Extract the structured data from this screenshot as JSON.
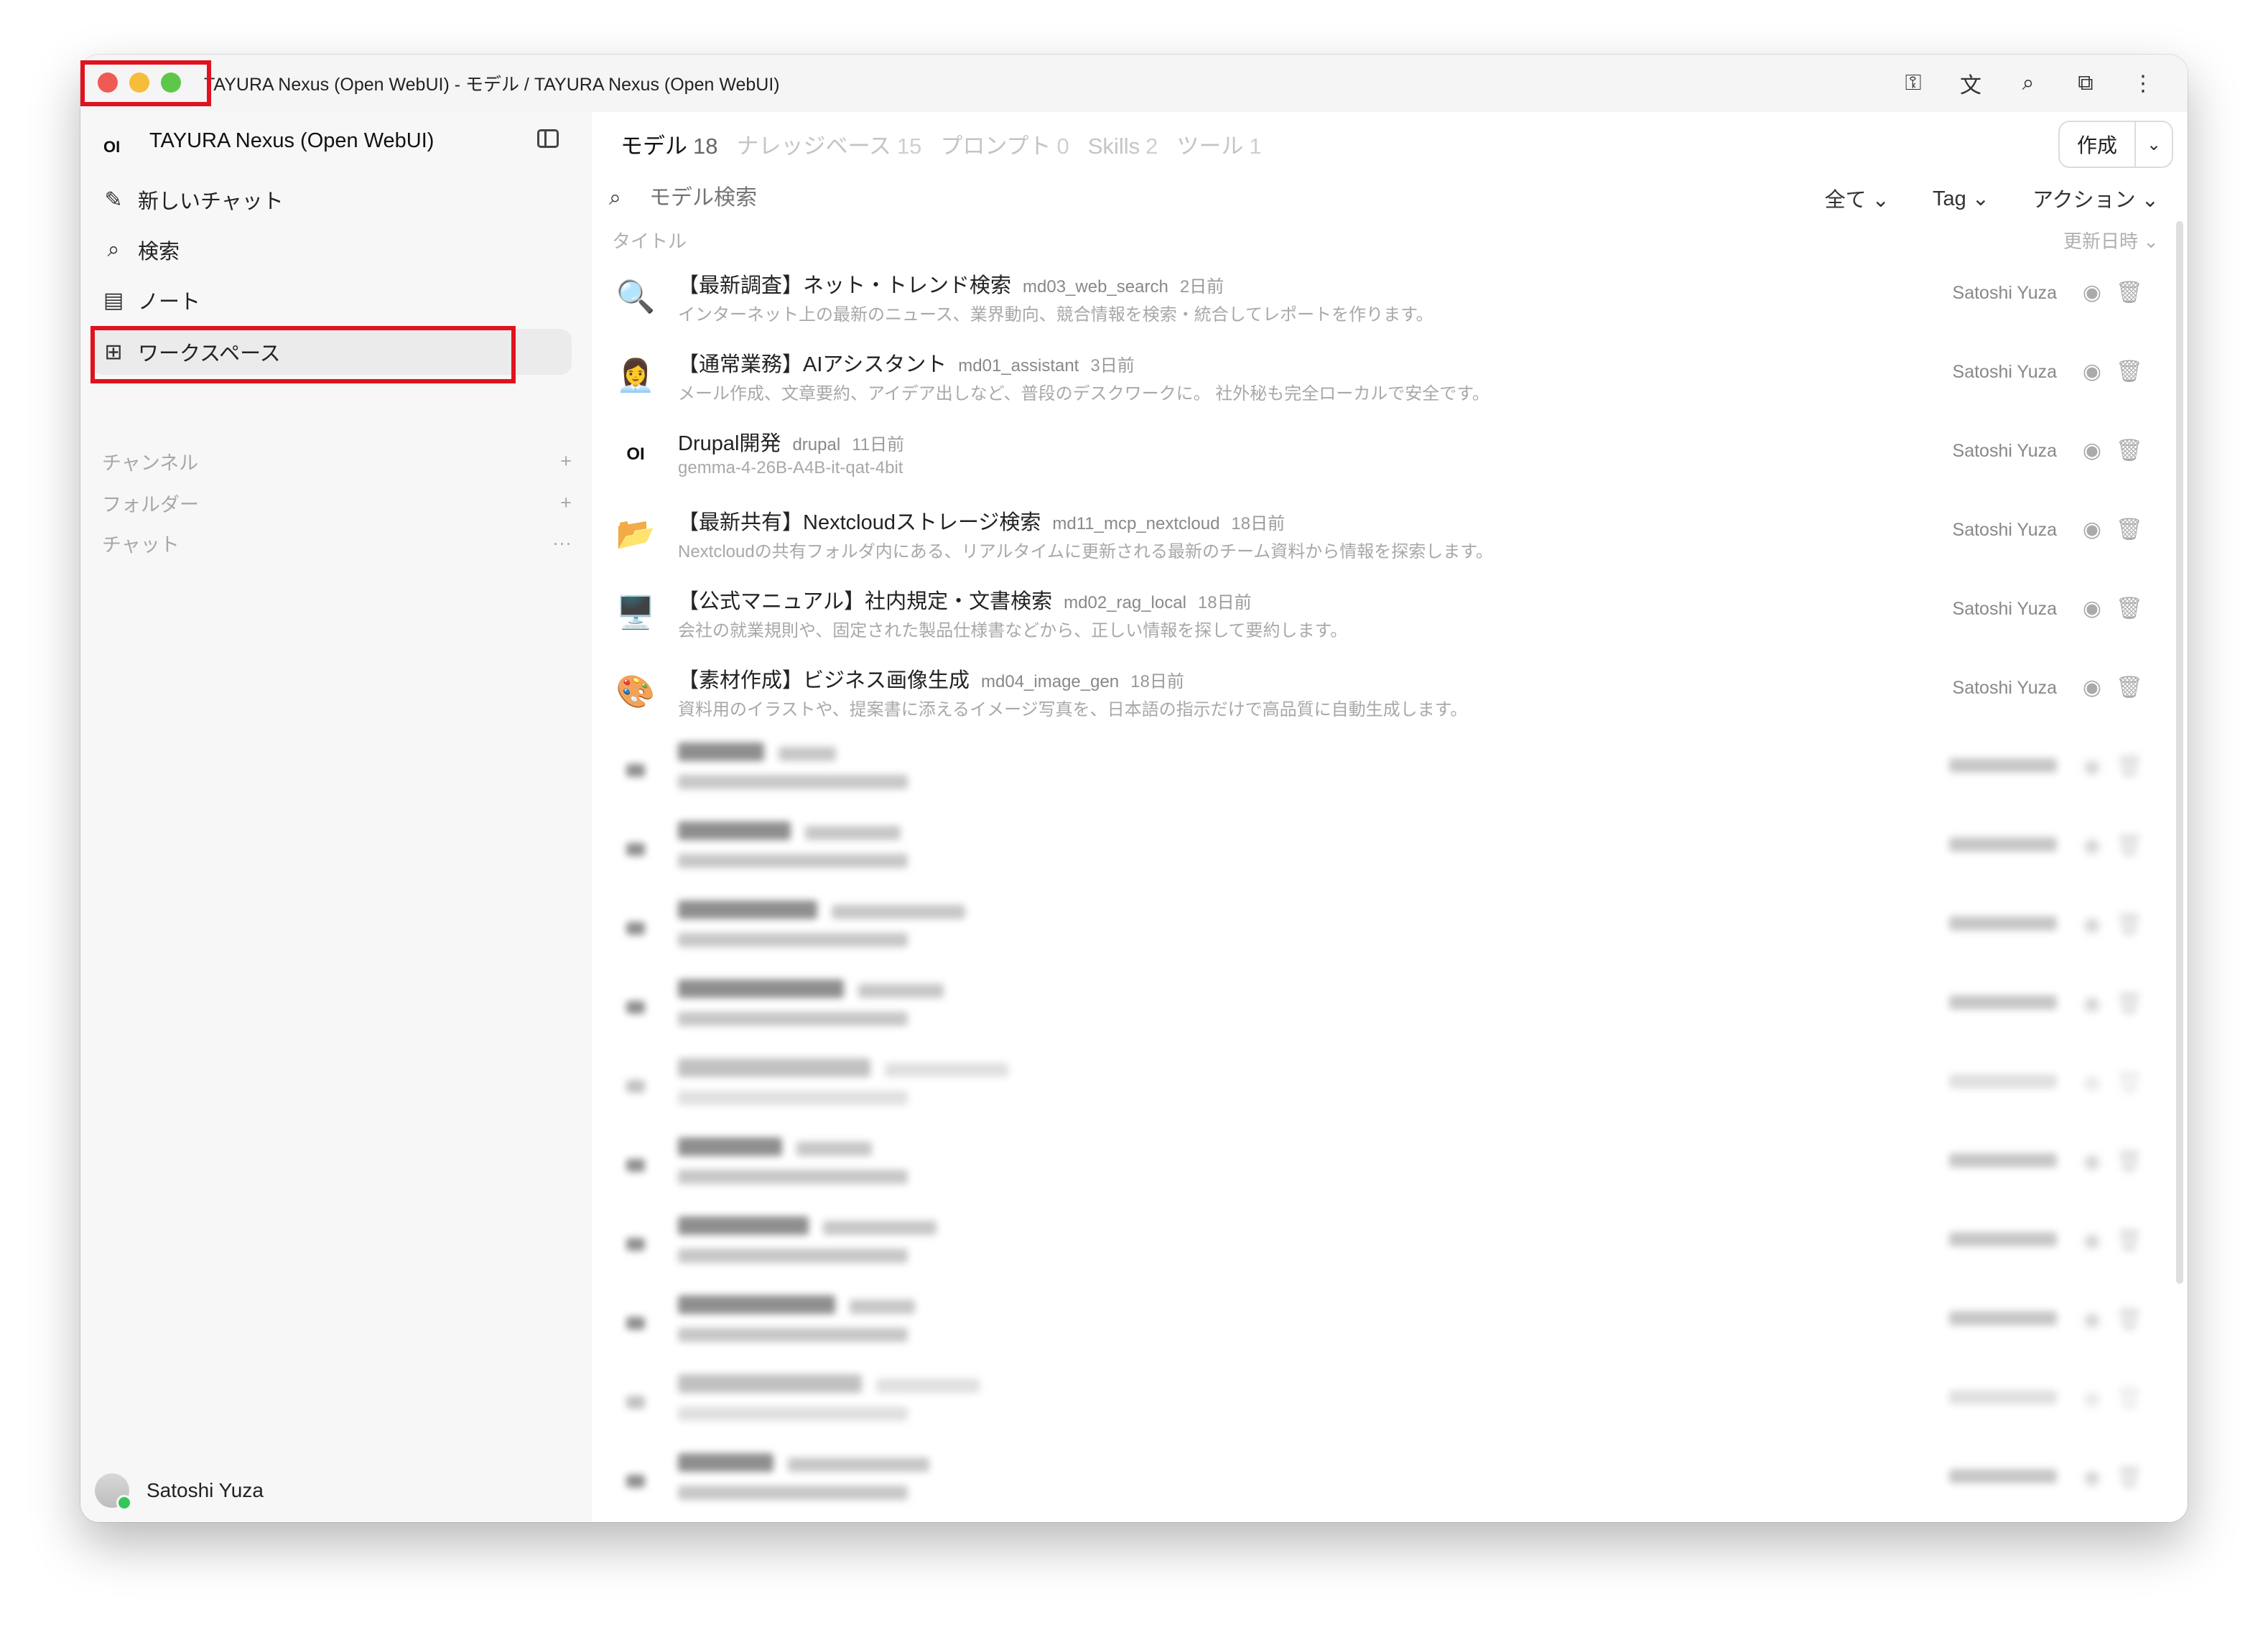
{
  "window": {
    "title": "TAYURA Nexus (Open WebUI) - モデル / TAYURA Nexus (Open WebUI)",
    "traffic_lights": [
      "#ee5b53",
      "#f6bd3b",
      "#5ec74a"
    ],
    "toolbar_icons": [
      "key-icon",
      "translate-icon",
      "zoom-icon",
      "extension-icon",
      "more-vertical-icon"
    ]
  },
  "sidebar": {
    "logo": "OI",
    "app_title": "TAYURA Nexus (Open WebUI)",
    "nav": [
      {
        "label": "新しいチャット",
        "icon": "pencil-icon"
      },
      {
        "label": "検索",
        "icon": "search-icon"
      },
      {
        "label": "ノート",
        "icon": "notebook-icon"
      },
      {
        "label": "ワークスペース",
        "icon": "workspace-grid-icon"
      }
    ],
    "sections": [
      {
        "label": "チャンネル",
        "action": "+"
      },
      {
        "label": "フォルダー",
        "action": "+"
      },
      {
        "label": "チャット",
        "action": "···"
      }
    ],
    "user": "Satoshi Yuza"
  },
  "main": {
    "tabs": [
      {
        "label": "モデル",
        "count": "18"
      },
      {
        "label": "ナレッジベース",
        "count": "15"
      },
      {
        "label": "プロンプト",
        "count": "0"
      },
      {
        "label": "Skills",
        "count": "2"
      },
      {
        "label": "ツール",
        "count": "1"
      }
    ],
    "create_label": "作成",
    "search_placeholder": "モデル検索",
    "filters": {
      "all": "全て",
      "tag": "Tag",
      "action": "アクション"
    },
    "column_title": "タイトル",
    "column_updated": "更新日時",
    "models": [
      {
        "icon": "🔍",
        "name": "【最新調査】ネット・トレンド検索",
        "id": "md03_web_search",
        "time": "2日前",
        "desc": "インターネット上の最新のニュース、業界動向、競合情報を検索・統合してレポートを作ります。",
        "owner": "Satoshi Yuza"
      },
      {
        "icon": "👩‍💼",
        "name": "【通常業務】AIアシスタント",
        "id": "md01_assistant",
        "time": "3日前",
        "desc": "メール作成、文章要約、アイデア出しなど、普段のデスクワークに。 社外秘も完全ローカルで安全です。",
        "owner": "Satoshi Yuza"
      },
      {
        "icon": "OI",
        "name": "Drupal開発",
        "id": "drupal",
        "time": "11日前",
        "desc": "gemma-4-26B-A4B-it-qat-4bit",
        "owner": "Satoshi Yuza"
      },
      {
        "icon": "📂",
        "name": "【最新共有】Nextcloudストレージ検索",
        "id": "md11_mcp_nextcloud",
        "time": "18日前",
        "desc": "Nextcloudの共有フォルダ内にある、リアルタイムに更新される最新のチーム資料から情報を探索します。",
        "owner": "Satoshi Yuza"
      },
      {
        "icon": "🖥️",
        "name": "【公式マニュアル】社内規定・文書検索",
        "id": "md02_rag_local",
        "time": "18日前",
        "desc": "会社の就業規則や、固定された製品仕様書などから、正しい情報を探して要約します。",
        "owner": "Satoshi Yuza"
      },
      {
        "icon": "🎨",
        "name": "【素材作成】ビジネス画像生成",
        "id": "md04_image_gen",
        "time": "18日前",
        "desc": "資料用のイラストや、提案書に添えるイメージ写真を、日本語の指示だけで高品質に自動生成します。",
        "owner": "Satoshi Yuza"
      }
    ],
    "blurred_rows": 10
  },
  "highlight_color": "#e0121f"
}
